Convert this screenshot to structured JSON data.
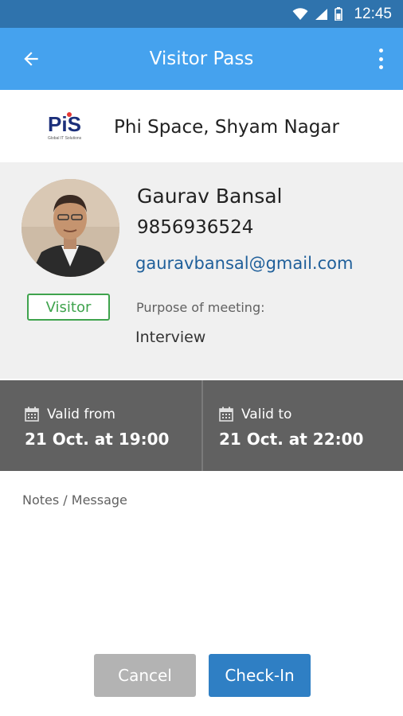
{
  "status_bar": {
    "time": "12:45",
    "icons": [
      "wifi-icon",
      "signal-icon",
      "battery-icon"
    ]
  },
  "app_bar": {
    "title": "Visitor Pass",
    "back_icon": "arrow-back-icon",
    "menu_icon": "more-vert-icon"
  },
  "organization": {
    "logo_text": "PiS",
    "logo_tagline": "Global IT Solutions",
    "name": "Phi Space, Shyam Nagar"
  },
  "visitor": {
    "name": "Gaurav Bansal",
    "phone": "9856936524",
    "email": "gauravbansal@gmail.com",
    "badge": "Visitor",
    "purpose_label": "Purpose of meeting:",
    "purpose": "Interview"
  },
  "validity": {
    "from_label": "Valid from",
    "from_value": "21 Oct. at 19:00",
    "to_label": "Valid to",
    "to_value": "21 Oct. at 22:00"
  },
  "notes": {
    "label": "Notes / Message"
  },
  "actions": {
    "cancel_label": "Cancel",
    "checkin_label": "Check-In"
  },
  "colors": {
    "status_bar": "#2f73ad",
    "app_bar": "#45a2ee",
    "badge": "#3fa34d",
    "email": "#1f5f9a",
    "validity_bg": "#616161",
    "cancel": "#b3b3b3",
    "checkin": "#2f7fc4"
  }
}
